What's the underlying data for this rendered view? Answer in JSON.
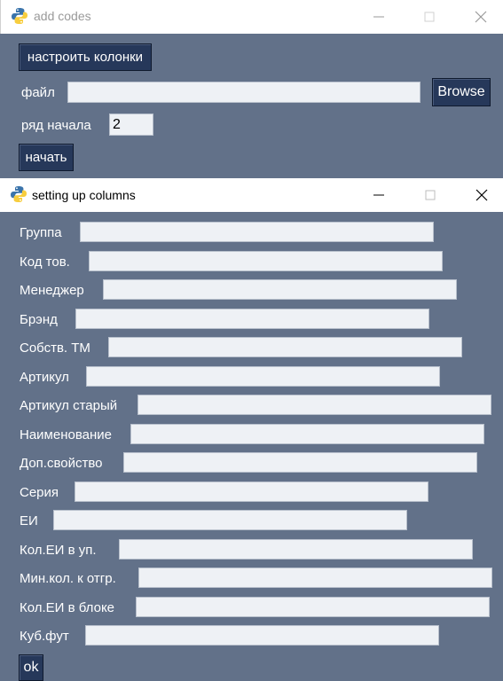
{
  "window1": {
    "title": "add codes",
    "setup_columns_button": "настроить колонки",
    "file_label": "файл",
    "file_value": "",
    "browse_button": "Browse",
    "start_row_label": "ряд начала",
    "start_row_value": "2",
    "start_button": "начать"
  },
  "window2": {
    "title": "setting up columns",
    "fields": [
      {
        "label": "Группа",
        "value": ""
      },
      {
        "label": "Код тов.",
        "value": ""
      },
      {
        "label": "Менеджер",
        "value": ""
      },
      {
        "label": "Брэнд",
        "value": ""
      },
      {
        "label": "Собств. ТМ",
        "value": ""
      },
      {
        "label": "Артикул",
        "value": ""
      },
      {
        "label": "Артикул старый",
        "value": ""
      },
      {
        "label": "Наименование",
        "value": ""
      },
      {
        "label": "Доп.свойство",
        "value": ""
      },
      {
        "label": "Серия",
        "value": ""
      },
      {
        "label": "ЕИ",
        "value": ""
      },
      {
        "label": "Кол.ЕИ в уп.",
        "value": ""
      },
      {
        "label": "Мин.кол. к отгр.",
        "value": ""
      },
      {
        "label": "Кол.ЕИ в блоке",
        "value": ""
      },
      {
        "label": "Куб.фут",
        "value": ""
      }
    ],
    "ok_button": "ok"
  },
  "colors": {
    "client_bg": "#627189",
    "button_bg": "#26385a",
    "entry_bg": "#eef1f5",
    "titlebar_bg": "#ffffff"
  },
  "icons": [
    "python-icon",
    "minimize-icon",
    "maximize-icon",
    "close-icon"
  ]
}
